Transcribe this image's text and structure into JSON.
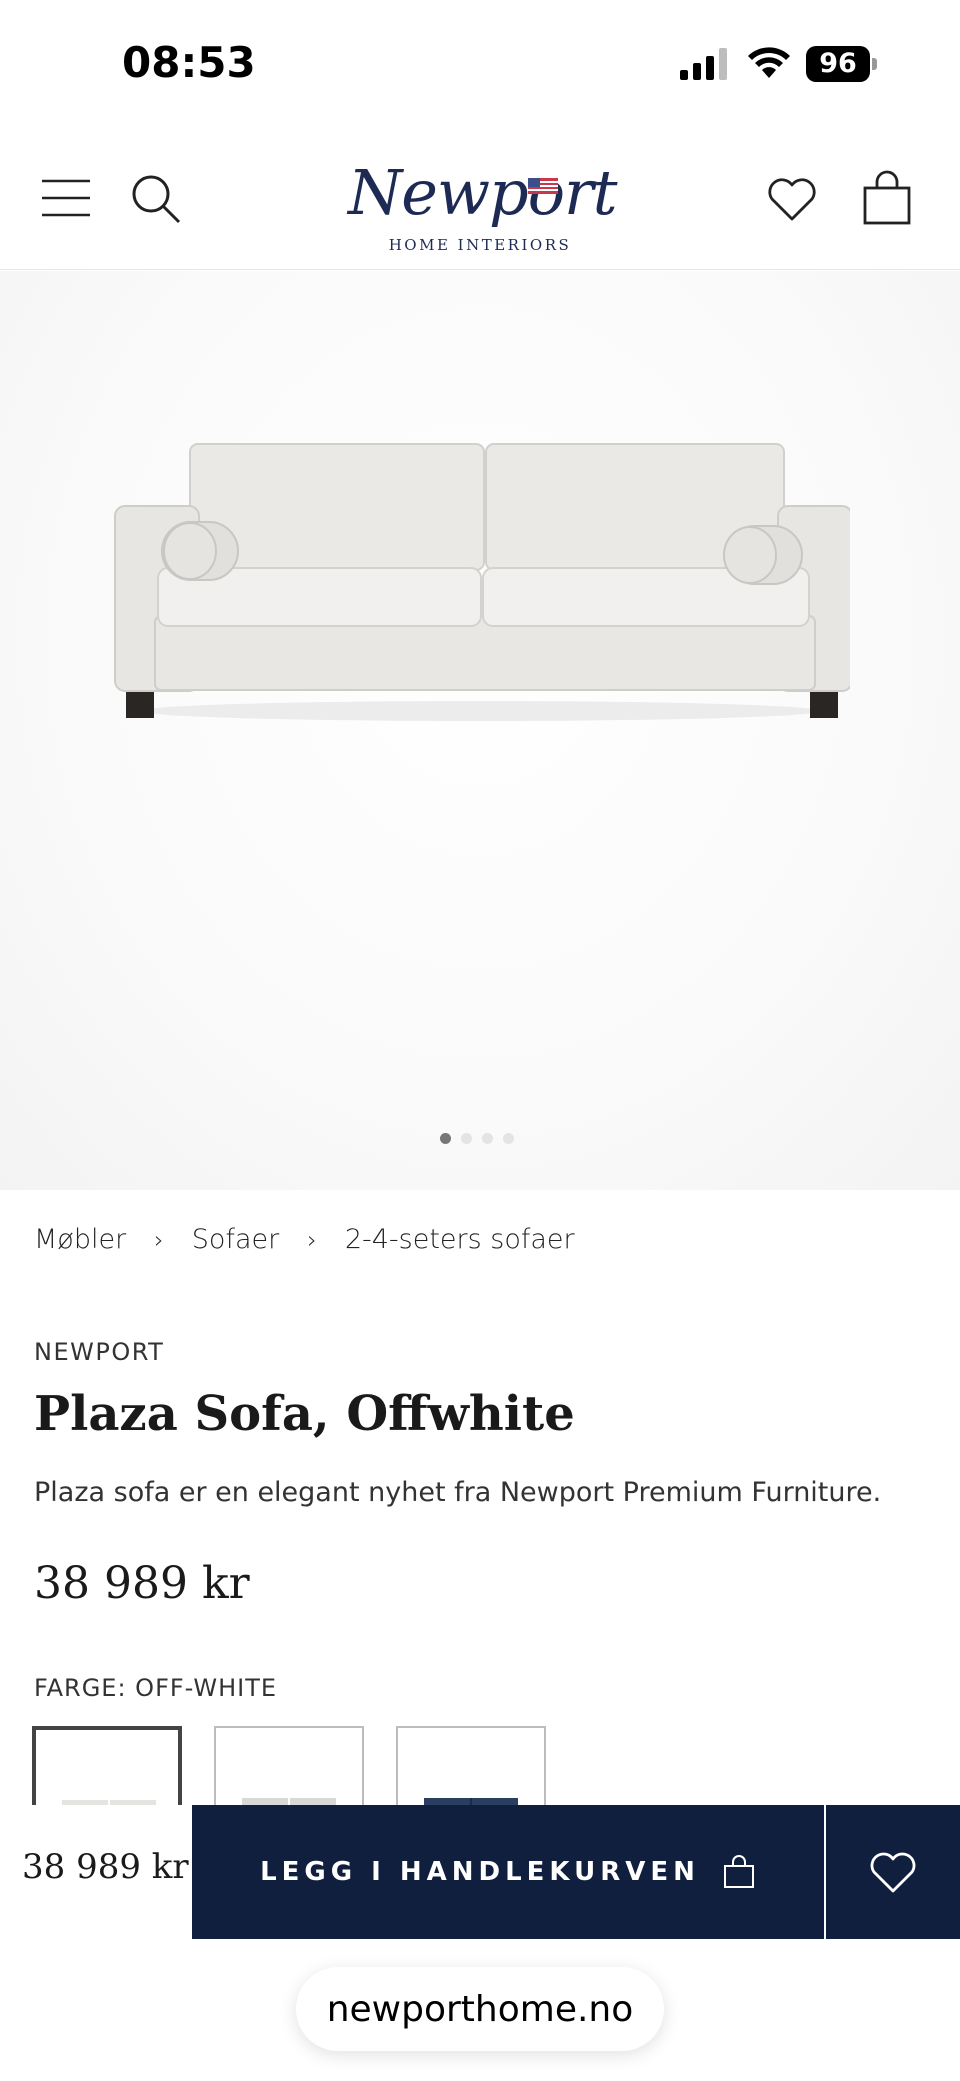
{
  "status_bar": {
    "time": "08:53",
    "battery": "96"
  },
  "header": {
    "logo_script": "Newport",
    "logo_sub": "HOME INTERIORS",
    "icons": [
      "menu-icon",
      "search-icon",
      "heart-icon",
      "bag-icon"
    ]
  },
  "gallery": {
    "image": "sofa-image",
    "slide_count": 4,
    "active_slide": 1
  },
  "breadcrumb": [
    "Møbler",
    "Sofaer",
    "2-4-seters sofaer"
  ],
  "product": {
    "brand": "NEWPORT",
    "title": "Plaza Sofa, Offwhite",
    "description": "Plaza sofa er en elegant nyhet fra Newport Premium Furniture.",
    "price": "38 989 kr",
    "color_label": "FARGE: OFF-WHITE",
    "swatches": [
      {
        "name": "off-white",
        "color": "#e6e4e0"
      },
      {
        "name": "light-grey",
        "color": "#d8d8d6"
      },
      {
        "name": "navy",
        "color": "#2a3f60"
      }
    ]
  },
  "buybar": {
    "price": "38 989 kr",
    "add_label": "LEGG I HANDLEKURVEN"
  },
  "browser": {
    "url": "newporthome.no"
  },
  "colors": {
    "navy": "#0f1f3d",
    "logo": "#1d2a54"
  }
}
